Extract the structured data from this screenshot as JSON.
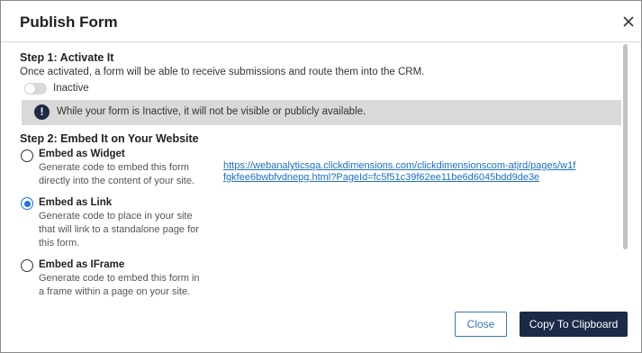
{
  "dialog": {
    "title": "Publish Form",
    "close_icon": "close-icon"
  },
  "step1": {
    "heading": "Step 1: Activate It",
    "description": "Once activated, a form will be able to receive submissions and route them into the CRM.",
    "toggle_state": "off",
    "toggle_label": "Inactive",
    "info_icon": "exclamation-icon",
    "info_text": "While your form is Inactive, it will not be visible or publicly available."
  },
  "step2": {
    "heading": "Step 2: Embed It on Your Website",
    "options": [
      {
        "title": "Embed as Widget",
        "desc_lines": [
          "Generate code to embed this form",
          "directly into the content of your site."
        ],
        "selected": false
      },
      {
        "title": "Embed as Link",
        "desc_lines": [
          "Generate code to place in your site",
          "that will link to a standalone page for",
          "this form."
        ],
        "selected": true
      },
      {
        "title": "Embed as IFrame",
        "desc_lines": [
          "Generate code to embed this form in",
          "a frame within a page on your site."
        ],
        "selected": false
      }
    ],
    "link_lines": [
      "https://webanalyticsqa.clickdimensions.com/clickdimensionscom-atjrd/pages/w1f",
      "fgkfee6bwbfvdnepg.html?PageId=fc5f51c39f62ee11be6d6045bdd9de3e"
    ]
  },
  "footer": {
    "close_label": "Close",
    "copy_label": "Copy To Clipboard"
  },
  "colors": {
    "accent": "#1a73e8",
    "primary_button": "#1b2a47",
    "banner_bg": "#d9d9d9",
    "link": "#1a6fc9"
  }
}
